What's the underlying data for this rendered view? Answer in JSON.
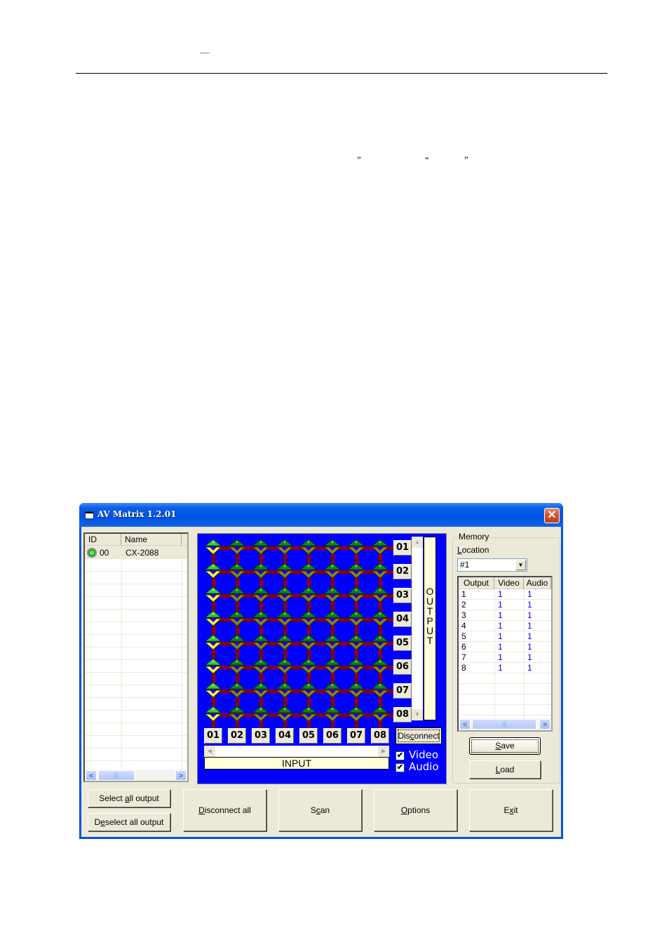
{
  "document": {
    "header_dash": "—",
    "quotes": [
      "”",
      "“",
      "”"
    ]
  },
  "window": {
    "title": "AV Matrix 1.2.01",
    "close_label": "✕",
    "device_list": {
      "columns": [
        "ID",
        "Name"
      ],
      "rows": [
        {
          "status_icon": "connected-led-icon",
          "id": "00",
          "name": "CX-2088"
        }
      ]
    },
    "matrix": {
      "inputs": [
        "01",
        "02",
        "03",
        "04",
        "05",
        "06",
        "07",
        "08"
      ],
      "outputs": [
        "01",
        "02",
        "03",
        "04",
        "05",
        "06",
        "07",
        "08"
      ],
      "connections": [
        1,
        1,
        1,
        1,
        1,
        1,
        1,
        1
      ],
      "output_label": "OUTPUT",
      "input_label": "INPUT",
      "disconnect_label": "Disconnect",
      "video_label": "Video",
      "audio_label": "Audio",
      "video_checked": true,
      "audio_checked": true,
      "colors": {
        "background": "#0000ff",
        "wire": "#8b0000",
        "node_active_top": "#33cc33",
        "node_active_bottom": "#ffff33",
        "node_idle_top": "#0a8a0a",
        "node_idle_bottom": "#8a8a00"
      }
    },
    "memory": {
      "group_label": "Memory",
      "location_label": "Location",
      "location_value": "#1",
      "table": {
        "columns": [
          "Output",
          "Video",
          "Audio"
        ],
        "rows": [
          [
            "1",
            "1",
            "1"
          ],
          [
            "2",
            "1",
            "1"
          ],
          [
            "3",
            "1",
            "1"
          ],
          [
            "4",
            "1",
            "1"
          ],
          [
            "5",
            "1",
            "1"
          ],
          [
            "6",
            "1",
            "1"
          ],
          [
            "7",
            "1",
            "1"
          ],
          [
            "8",
            "1",
            "1"
          ]
        ]
      },
      "save_label": "Save",
      "load_label": "Load"
    },
    "buttons": {
      "select_all": "Select all output",
      "deselect_all": "Deselect all output",
      "disconnect_all": "Disconnect all",
      "scan": "Scan",
      "options": "Options",
      "exit": "Exit"
    }
  }
}
